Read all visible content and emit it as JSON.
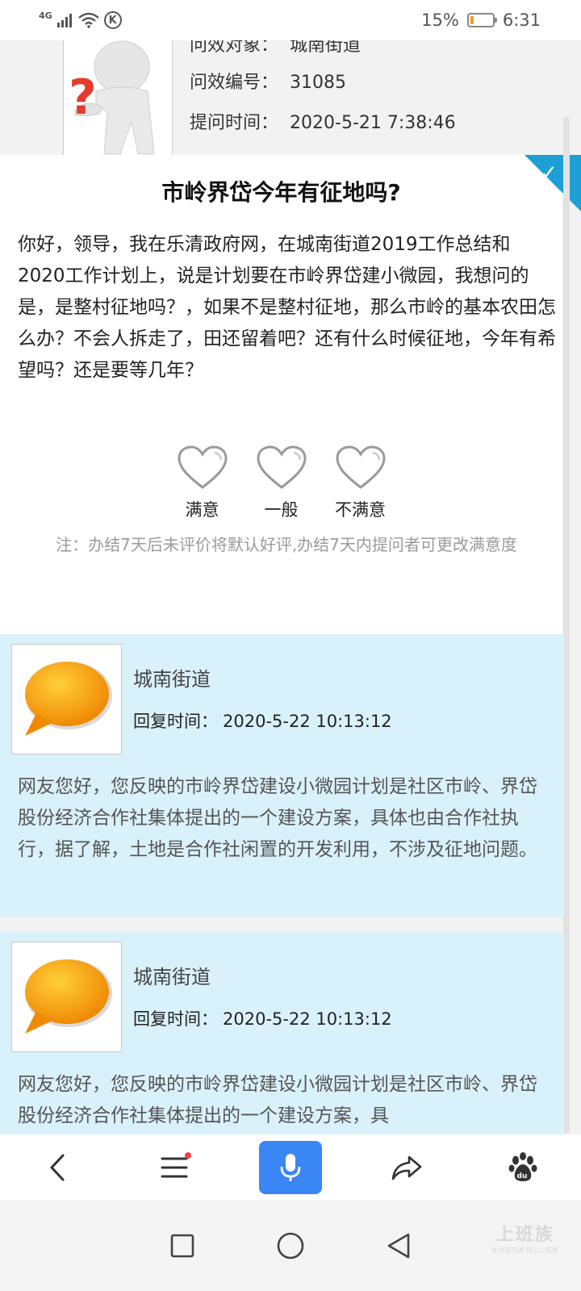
{
  "status_bar": {
    "network": "4G",
    "battery_percent": "15%",
    "battery_level": 0.15,
    "time": "6:31"
  },
  "question": {
    "target_label": "问效对象：",
    "target_value": "城南街道",
    "id_label": "问效编号：",
    "id_value": "31085",
    "time_label": "提问时间：",
    "time_value": "2020-5-21 7:38:46",
    "title": "市岭界岱今年有征地吗?",
    "body": "你好，领导，我在乐清政府网，在城南街道2019工作总结和2020工作计划上，说是计划要在市岭界岱建小微园，我想问的是，是整村征地吗？，如果不是整村征地，那么市岭的基本农田怎么办？不会人拆走了，田还留着吧？还有什么时候征地，今年有希望吗？还是要等几年？"
  },
  "rating": {
    "options": [
      "满意",
      "一般",
      "不满意"
    ],
    "note": "注：办结7天后未评价将默认好评,办结7天内提问者可更改满意度"
  },
  "replies": [
    {
      "name": "城南街道",
      "time_label": "回复时间：",
      "time_value": "2020-5-22 10:13:12",
      "body": "网友您好，您反映的市岭界岱建设小微园计划是社区市岭、界岱股份经济合作社集体提出的一个建设方案，具体也由合作社执行，据了解，土地是合作社闲置的开发利用，不涉及征地问题。"
    },
    {
      "name": "城南街道",
      "time_label": "回复时间：",
      "time_value": "2020-5-22 10:13:12",
      "body": "网友您好，您反映的市岭界岱建设小微园计划是社区市岭、界岱股份经济合作社集体提出的一个建设方案，具"
    }
  ],
  "toolbar": {
    "icons": [
      "back-icon",
      "menu-icon",
      "microphone-icon",
      "share-icon",
      "baidu-paw-icon"
    ],
    "baidu_text": "du"
  },
  "watermark": {
    "main": "上班族",
    "sub": "生活在乐清 网上上班族"
  },
  "colors": {
    "accent": "#3a86f5",
    "badge": "#1e9fd6",
    "reply_bg": "#d9f1fb",
    "battery": "#f39a1a"
  }
}
